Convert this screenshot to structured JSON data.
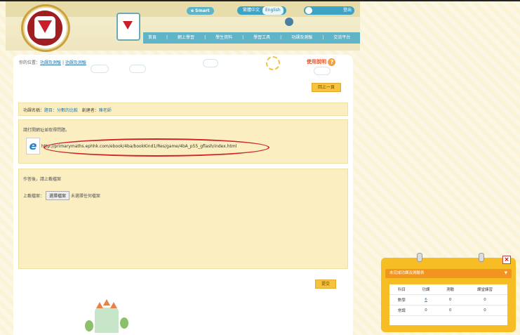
{
  "header": {
    "smart_label": "Smart",
    "lang_tc": "繁體中文",
    "lang_en": "English",
    "user_name": "",
    "logout": "登出",
    "nav": [
      "首頁",
      "網上學習",
      "學生資料",
      "學習工具",
      "功課及測驗",
      "交流平台"
    ]
  },
  "breadcrumb": {
    "prefix": "你的位置：",
    "item1": "功課及測驗",
    "sep": " | ",
    "item2": "功課及測驗"
  },
  "help_label": "使用說明",
  "back_button": "回上一頁",
  "assignment": {
    "name_label": "功課名稱：",
    "name_value": "題目：分數的比較",
    "creator_label": "創建者：",
    "creator_value": "陳老師"
  },
  "link_section": {
    "instruction": "請打開網址並取得問題。",
    "url": "http://primarymaths.ephhk.com/ebook/4ba/bookKind1/Res/game/4bA_p55_gflash/index.html"
  },
  "upload_section": {
    "instruction": "作答後，請上載檔案",
    "file_label": "上載檔案：",
    "choose_button": "選擇檔案",
    "no_file": "未選擇任何檔案"
  },
  "submit_button": "提交",
  "popup": {
    "title": "未完成功課及測驗表",
    "headers": [
      "科目",
      "功課",
      "測驗",
      "課堂練習"
    ],
    "rows": [
      {
        "subject": "數學",
        "homework": "6",
        "quiz": "0",
        "practice": "0"
      },
      {
        "subject": "常識",
        "homework": "0",
        "quiz": "0",
        "practice": "0"
      }
    ]
  },
  "colors": {
    "accent": "#5fb4c7",
    "box_bg": "#fbefc1",
    "button": "#f7c23f",
    "highlight_ellipse": "#d0232d",
    "popup": "#f7bd25"
  }
}
